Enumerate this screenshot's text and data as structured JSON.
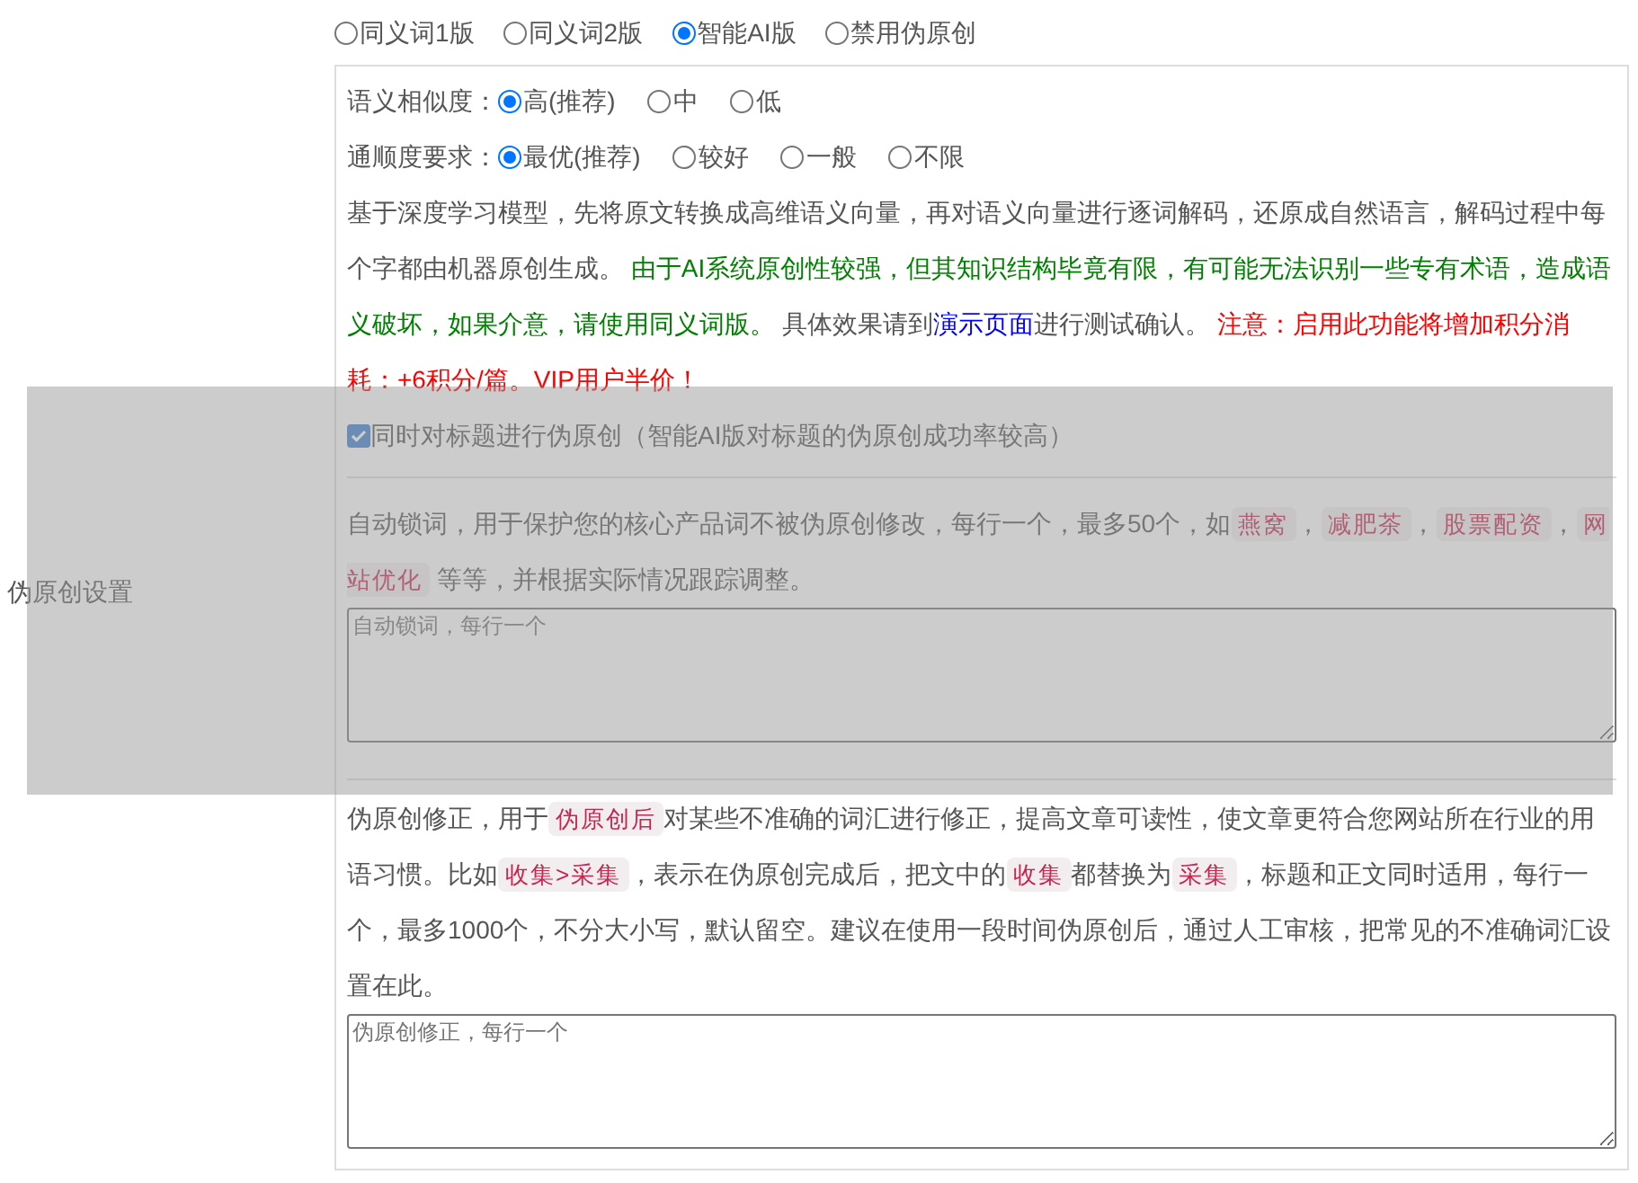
{
  "row_label": "伪原创设置",
  "modes": [
    {
      "label": "同义词1版",
      "selected": false
    },
    {
      "label": "同义词2版",
      "selected": false
    },
    {
      "label": "智能AI版",
      "selected": true
    },
    {
      "label": "禁用伪原创",
      "selected": false
    }
  ],
  "similarity": {
    "label": "语义相似度：",
    "options": [
      {
        "label": "高(推荐)",
        "selected": true
      },
      {
        "label": "中",
        "selected": false
      },
      {
        "label": "低",
        "selected": false
      }
    ]
  },
  "fluency": {
    "label": "通顺度要求：",
    "options": [
      {
        "label": "最优(推荐)",
        "selected": true
      },
      {
        "label": "较好",
        "selected": false
      },
      {
        "label": "一般",
        "selected": false
      },
      {
        "label": "不限",
        "selected": false
      }
    ]
  },
  "description": [
    {
      "kind": "plain",
      "text": "基于深度学习模型，先将原文转换成高维语义向量，再对语义向量进行逐词解码，还原成自然语言，解码过程中每个字都由机器原创生成。 "
    },
    {
      "kind": "green",
      "text": "由于AI系统原创性较强，但其知识结构毕竟有限，有可能无法识别一些专有术语，造成语义破坏，如果介意，请使用同义词版。"
    },
    {
      "kind": "plain",
      "text": " 具体效果请到"
    },
    {
      "kind": "link",
      "text": "演示页面"
    },
    {
      "kind": "plain",
      "text": "进行测试确认。 "
    },
    {
      "kind": "red",
      "text": "注意：启用此功能将增加积分消耗：+6积分/篇。VIP用户半价！"
    }
  ],
  "title_option": {
    "label": "同时对标题进行伪原创（智能AI版对标题的伪原创成功率较高）",
    "checked": true
  },
  "lock_words": {
    "description": [
      {
        "kind": "plain",
        "text": "自动锁词，用于保护您的核心产品词不被伪原创修改，每行一个，最多50个，如"
      },
      {
        "kind": "tag",
        "text": "燕窝"
      },
      {
        "kind": "plain",
        "text": "，"
      },
      {
        "kind": "tag",
        "text": "减肥茶"
      },
      {
        "kind": "plain",
        "text": "，"
      },
      {
        "kind": "tag",
        "text": "股票配资"
      },
      {
        "kind": "plain",
        "text": "，"
      },
      {
        "kind": "tag",
        "text": "网站优化"
      },
      {
        "kind": "plain",
        "text": " 等等，并根据实际情况跟踪调整。"
      }
    ],
    "placeholder": "自动锁词，每行一个"
  },
  "corrections": {
    "description": [
      {
        "kind": "plain",
        "text": "伪原创修正，用于"
      },
      {
        "kind": "tag",
        "text": "伪原创后"
      },
      {
        "kind": "plain",
        "text": "对某些不准确的词汇进行修正，提高文章可读性，使文章更符合您网站所在行业的用语习惯。比如"
      },
      {
        "kind": "tag",
        "text": "收集>采集"
      },
      {
        "kind": "plain",
        "text": "，表示在伪原创完成后，把文中的"
      },
      {
        "kind": "tag",
        "text": "收集"
      },
      {
        "kind": "plain",
        "text": "都替换为"
      },
      {
        "kind": "tag",
        "text": "采集"
      },
      {
        "kind": "plain",
        "text": "，标题和正文同时适用，每行一个，最多1000个，不分大小写，默认留空。建议在使用一段时间伪原创后，通过人工审核，把常见的不准确词汇设置在此。"
      }
    ],
    "placeholder": "伪原创修正，每行一个"
  }
}
